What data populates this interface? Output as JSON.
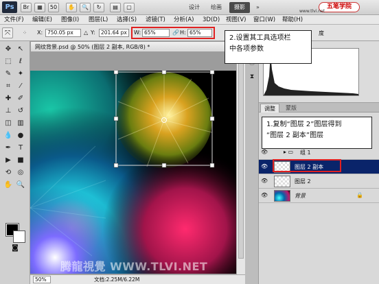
{
  "app": {
    "logo_text": "Ps",
    "workspaces": [
      "设计",
      "绘画",
      "摄影"
    ],
    "active_workspace": "摄影",
    "brand_main": "五笔学院",
    "brand_sub": "www.tlvi.net"
  },
  "menu": [
    "文件(F)",
    "编辑(E)",
    "图像(I)",
    "图层(L)",
    "选择(S)",
    "滤镜(T)",
    "分析(A)",
    "3D(D)",
    "视图(V)",
    "窗口(W)",
    "帮助(H)"
  ],
  "options": {
    "x_label": "X:",
    "x_value": "750.05 px",
    "y_label": "Y:",
    "y_value": "201.64 px",
    "w_label": "W:",
    "w_value": "65%",
    "h_label": "H:",
    "h_value": "65%",
    "angle_unit": "度"
  },
  "document": {
    "tab_title": "网纹背景.psd @ 50% (图层 2 副本, RGB/8) *",
    "zoom": "50%",
    "doc_size": "文档:2.25M/6.22M",
    "watermark": "腾龍視覺 WWW.TLVI.NET"
  },
  "panels": {
    "tab_adjust": "调整",
    "tab_mask": "蒙版"
  },
  "layers": [
    {
      "name": "组 1",
      "kind": "group"
    },
    {
      "name": "图层 2 副本",
      "kind": "layer",
      "selected": true
    },
    {
      "name": "图层 2",
      "kind": "layer"
    },
    {
      "name": "背景",
      "kind": "background"
    }
  ],
  "callouts": {
    "step2_line1": "2.设置其工具选项栏",
    "step2_line2": "中各项参数",
    "step1_line1": "1.复制“图层 2”图层得到",
    "step1_line2": "“图层 2 副本”图层"
  },
  "colors": {
    "highlight_red": "#e02020",
    "selected_layer": "#0a246a",
    "foreground": "#000000",
    "background": "#ffffff"
  }
}
